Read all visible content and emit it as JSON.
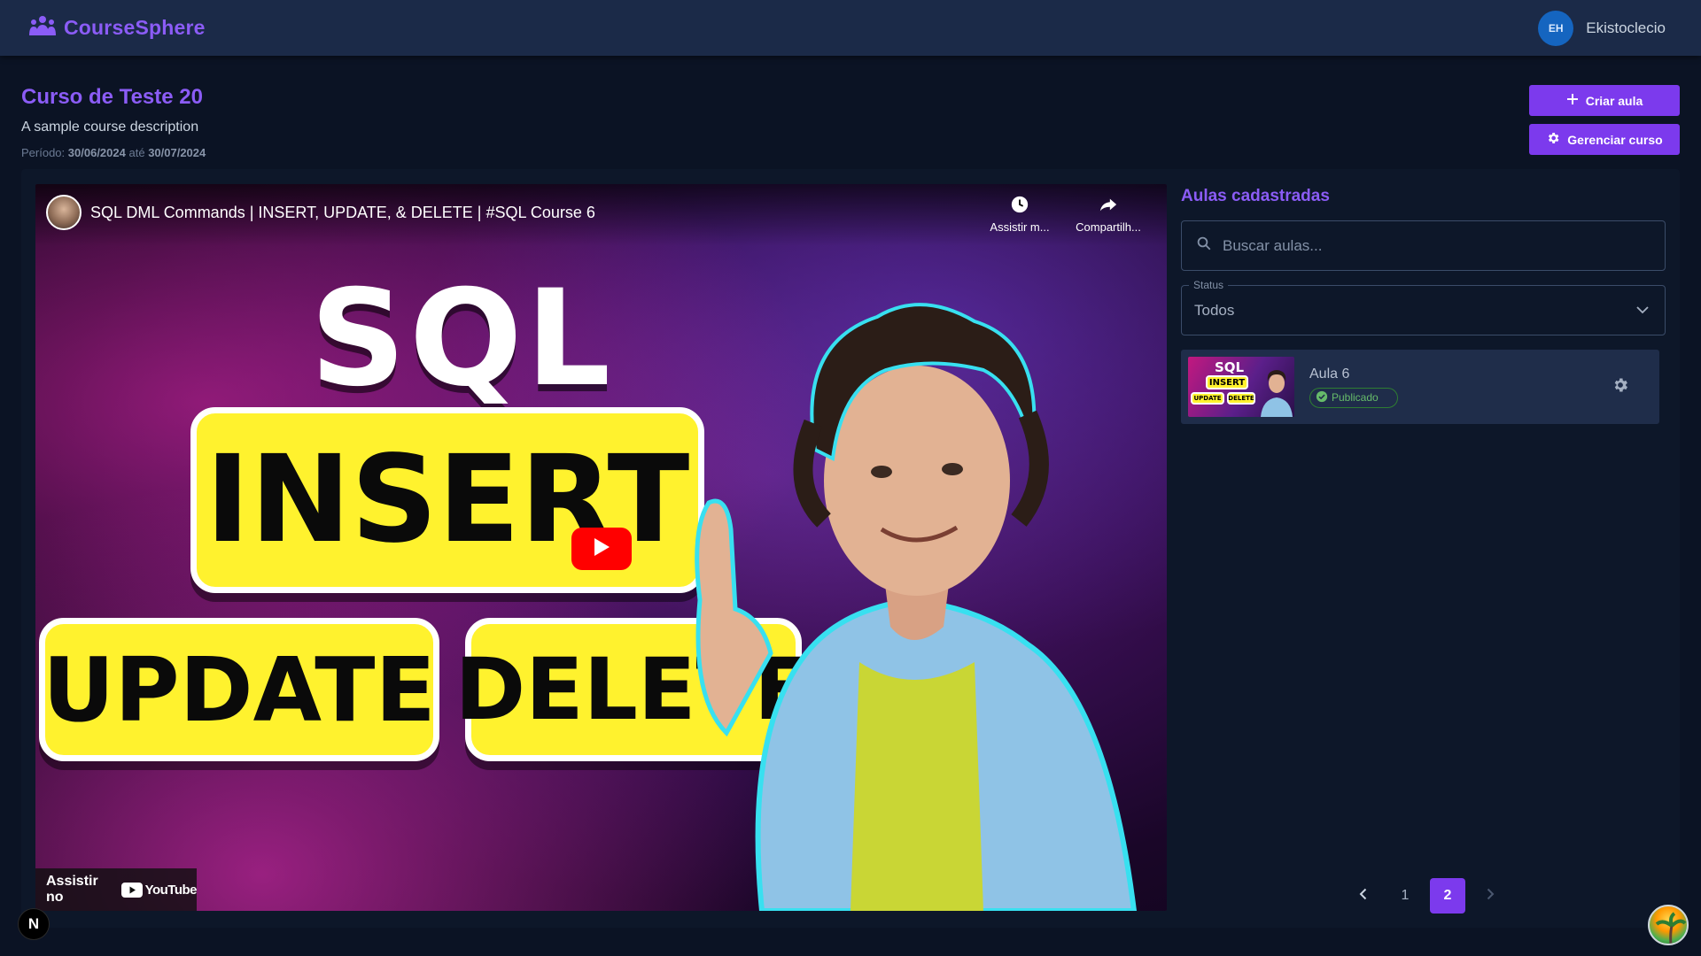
{
  "header": {
    "brand": "CourseSphere",
    "user_initials": "EH",
    "user_name": "Ekistoclecio"
  },
  "course": {
    "title": "Curso de Teste 20",
    "description": "A sample course description",
    "period_label": "Período:",
    "start_date": "30/06/2024",
    "between": "até",
    "end_date": "30/07/2024"
  },
  "actions": {
    "create_label": "Criar aula",
    "manage_label": "Gerenciar curso"
  },
  "video": {
    "title": "SQL DML Commands | INSERT, UPDATE, & DELETE | #SQL Course 6",
    "watch_later": "Assistir m...",
    "share": "Compartilh...",
    "watch_on": "Assistir no",
    "youtube": "YouTube",
    "thumb_sql": "SQL",
    "thumb_insert": "INSERT",
    "thumb_update": "UPDATE",
    "thumb_delete": "DELETE"
  },
  "lessons": {
    "title": "Aulas cadastradas",
    "search_placeholder": "Buscar aulas...",
    "status_label": "Status",
    "status_value": "Todos",
    "items": [
      {
        "name": "Aula 6",
        "status": "Publicado",
        "thumb_sql": "SQL",
        "thumb_insert": "INSERT",
        "thumb_update": "UPDATE",
        "thumb_delete": "DELETE"
      }
    ]
  },
  "pagination": {
    "pages": [
      "1",
      "2"
    ],
    "current": "2"
  },
  "misc": {
    "next_badge": "N"
  },
  "colors": {
    "accent": "#7c3aed",
    "accent_text": "#8b5cf6",
    "header_bg": "#1b2a48",
    "page_bg": "#0b1324",
    "success": "#66bb6a"
  }
}
